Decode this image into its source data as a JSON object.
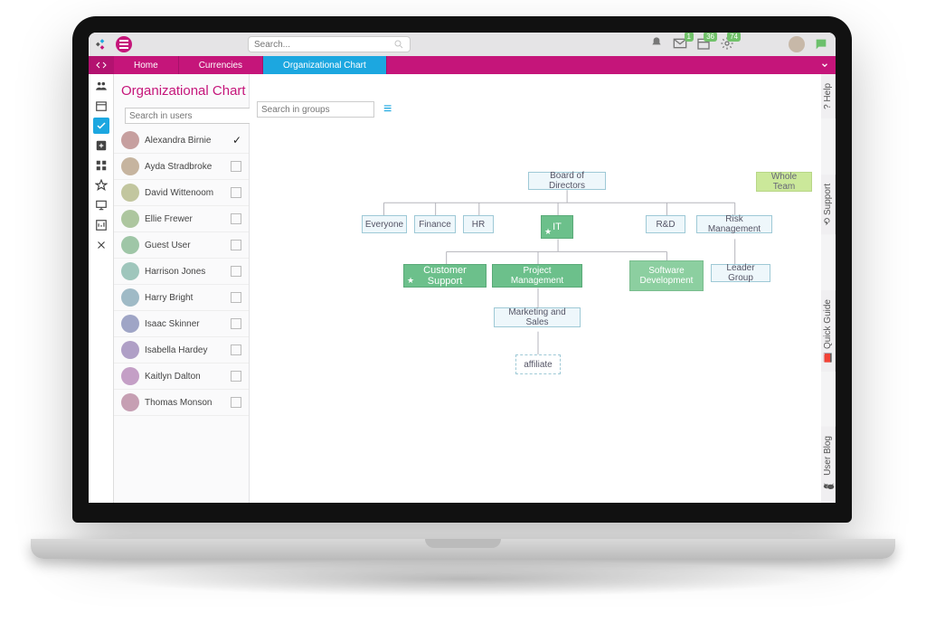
{
  "top": {
    "search_placeholder": "Search...",
    "badges": {
      "mail": "1",
      "calendar": "36",
      "gear": "74"
    }
  },
  "tabs": {
    "home": "Home",
    "currencies": "Currencies",
    "orgchart": "Organizational Chart"
  },
  "page_title": "Organizational Chart",
  "user_search_placeholder": "Search in users",
  "group_search_placeholder": "Search in groups",
  "users": [
    {
      "name": "Alexandra Birnie",
      "selected": true
    },
    {
      "name": "Ayda Stradbroke",
      "selected": false
    },
    {
      "name": "David Wittenoom",
      "selected": false
    },
    {
      "name": "Ellie Frewer",
      "selected": false
    },
    {
      "name": "Guest User",
      "selected": false
    },
    {
      "name": "Harrison Jones",
      "selected": false
    },
    {
      "name": "Harry Bright",
      "selected": false
    },
    {
      "name": "Isaac Skinner",
      "selected": false
    },
    {
      "name": "Isabella Hardey",
      "selected": false
    },
    {
      "name": "Kaitlyn Dalton",
      "selected": false
    },
    {
      "name": "Thomas Monson",
      "selected": false
    }
  ],
  "help_tabs": [
    "? Help",
    "⟲ Support",
    "📕 Quick Guide",
    "🗪 User Blog"
  ],
  "chart_data": {
    "type": "tree",
    "nodes": {
      "root": {
        "label": "Board of Directors",
        "style": "plain"
      },
      "every": {
        "label": "Everyone",
        "style": "plain",
        "parent": "root"
      },
      "fin": {
        "label": "Finance",
        "style": "plain",
        "parent": "root"
      },
      "hr": {
        "label": "HR",
        "style": "plain",
        "parent": "root"
      },
      "it": {
        "label": "IT",
        "style": "green",
        "star": true,
        "parent": "root"
      },
      "rd": {
        "label": "R&D",
        "style": "plain",
        "parent": "root"
      },
      "risk": {
        "label": "Risk Management",
        "style": "plain",
        "parent": "root"
      },
      "cs": {
        "label": "Customer Support",
        "style": "green",
        "star": true,
        "parent": "it"
      },
      "pm": {
        "label": "Project Management",
        "style": "green",
        "parent": "it"
      },
      "sd": {
        "label": "Software Development",
        "style": "green2",
        "parent": "it"
      },
      "mkt": {
        "label": "Marketing and Sales",
        "style": "plain",
        "parent": "pm"
      },
      "affil": {
        "label": "affiliate",
        "style": "dashed",
        "parent": "mkt"
      },
      "lead": {
        "label": "Leader Group",
        "style": "plain",
        "parent": "risk"
      },
      "whole": {
        "label": "Whole Team",
        "style": "lime",
        "detached": true
      }
    }
  }
}
